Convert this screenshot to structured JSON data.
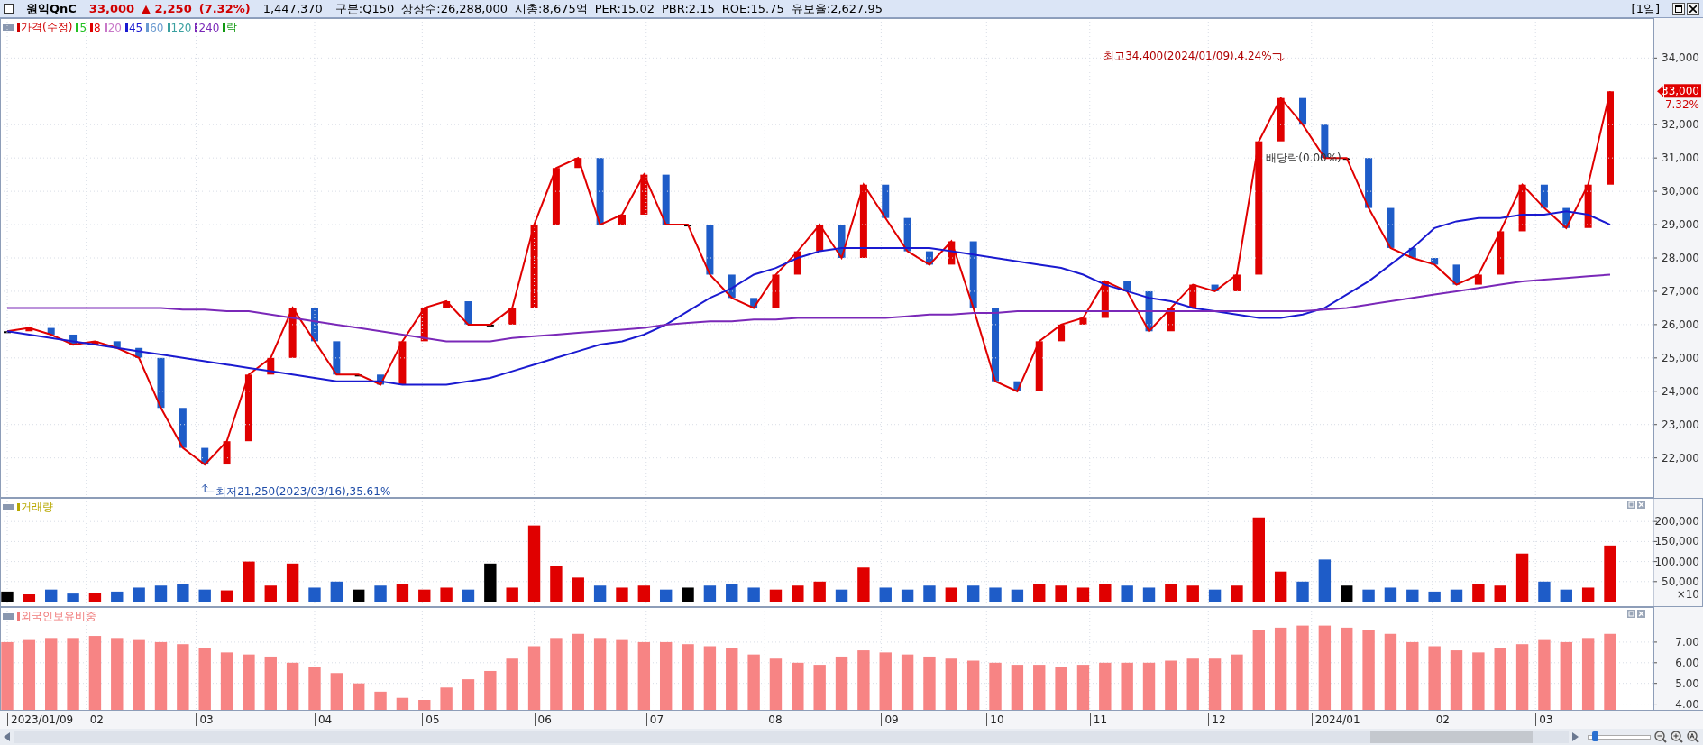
{
  "header": {
    "checked": false,
    "stock_name": "원익QnC",
    "price": "33,000",
    "change": "▲ 2,250",
    "change_rate": "(7.32%)",
    "volume": "1,447,370",
    "stats": [
      "구분:Q150",
      "상장수:26,288,000",
      "시총:8,675억",
      "PER:15.02",
      "PBR:2.15",
      "ROE:15.75",
      "유보율:2,627.95"
    ],
    "period": "[1일]"
  },
  "price_panel": {
    "legend": [
      {
        "label": "가격(수정)",
        "color": "#d00000"
      },
      {
        "label": "5",
        "color": "#22c022"
      },
      {
        "label": "8",
        "color": "#e00000"
      },
      {
        "label": "20",
        "color": "#c878c8"
      },
      {
        "label": "45",
        "color": "#1a1ad0"
      },
      {
        "label": "60",
        "color": "#6a9ad0"
      },
      {
        "label": "120",
        "color": "#3aa0a0"
      },
      {
        "label": "240",
        "color": "#7a28b8"
      },
      {
        "label": "락",
        "color": "#119911"
      }
    ],
    "chart_data": {
      "type": "line",
      "grid": true,
      "ylim": [
        20800,
        35200
      ],
      "yticks": [
        {
          "value": 22000,
          "label": "22,000"
        },
        {
          "value": 23000,
          "label": "23,000"
        },
        {
          "value": 24000,
          "label": "24,000"
        },
        {
          "value": 25000,
          "label": "25,000"
        },
        {
          "value": 26000,
          "label": "26,000"
        },
        {
          "value": 27000,
          "label": "27,000"
        },
        {
          "value": 28000,
          "label": "28,000"
        },
        {
          "value": 29000,
          "label": "29,000"
        },
        {
          "value": 30000,
          "label": "30,000"
        },
        {
          "value": 31000,
          "label": "31,000"
        },
        {
          "value": 32000,
          "label": "32,000"
        },
        {
          "value": 34000,
          "label": "34,000"
        }
      ],
      "series": [
        {
          "color": "#e00000",
          "values": [
            25800,
            25900,
            25700,
            25400,
            25500,
            25300,
            25000,
            23500,
            22300,
            21800,
            22500,
            24500,
            25000,
            26500,
            25500,
            24500,
            24500,
            24200,
            25500,
            26500,
            26700,
            26000,
            26000,
            26500,
            29000,
            30700,
            31000,
            29000,
            29300,
            30500,
            29000,
            29000,
            27500,
            26800,
            26500,
            27500,
            28200,
            29000,
            28000,
            30200,
            29200,
            28200,
            27800,
            28500,
            26500,
            24300,
            24000,
            25500,
            26000,
            26200,
            27300,
            27000,
            25800,
            26500,
            27200,
            27000,
            27500,
            31500,
            32800,
            32000,
            31000,
            31000,
            29500,
            28300,
            28000,
            27800,
            27200,
            27500,
            28800,
            30200,
            29500,
            28900,
            30200,
            33000
          ]
        },
        {
          "color": "#1a1ad0",
          "values": [
            25800,
            25700,
            25600,
            25500,
            25400,
            25300,
            25200,
            25100,
            25000,
            24900,
            24800,
            24700,
            24600,
            24500,
            24400,
            24300,
            24300,
            24300,
            24200,
            24200,
            24200,
            24300,
            24400,
            24600,
            24800,
            25000,
            25200,
            25400,
            25500,
            25700,
            26000,
            26400,
            26800,
            27100,
            27500,
            27700,
            28000,
            28200,
            28300,
            28300,
            28300,
            28300,
            28300,
            28200,
            28100,
            28000,
            27900,
            27800,
            27700,
            27500,
            27200,
            27000,
            26800,
            26700,
            26500,
            26400,
            26300,
            26200,
            26200,
            26300,
            26500,
            26900,
            27300,
            27800,
            28300,
            28900,
            29100,
            29200,
            29200,
            29300,
            29300,
            29400,
            29300,
            29000
          ]
        },
        {
          "color": "#7a28b8",
          "values": [
            26500,
            26500,
            26500,
            26500,
            26500,
            26500,
            26500,
            26500,
            26450,
            26450,
            26400,
            26400,
            26300,
            26200,
            26100,
            26000,
            25900,
            25800,
            25700,
            25600,
            25500,
            25500,
            25500,
            25600,
            25650,
            25700,
            25750,
            25800,
            25850,
            25900,
            26000,
            26050,
            26100,
            26100,
            26150,
            26150,
            26200,
            26200,
            26200,
            26200,
            26200,
            26250,
            26300,
            26300,
            26350,
            26350,
            26400,
            26400,
            26400,
            26400,
            26400,
            26400,
            26400,
            26400,
            26400,
            26400,
            26400,
            26400,
            26400,
            26400,
            26450,
            26500,
            26600,
            26700,
            26800,
            26900,
            27000,
            27100,
            27200,
            27300,
            27350,
            27400,
            27450,
            27500
          ]
        }
      ],
      "annotations": [
        "최고34,400(2024/01/09),4.24%",
        "최저21,250(2023/03/16),35.61%",
        "배당락(0.00%)"
      ]
    },
    "price_tag": {
      "price": "33,000",
      "change": "7.32%"
    }
  },
  "volume_panel": {
    "legend": [
      {
        "label": "거래량",
        "color": "#b8a800"
      }
    ],
    "unit": "×10",
    "chart_data": {
      "type": "bar",
      "grid": true,
      "ylim": [
        0,
        259000
      ],
      "yticks": [
        {
          "value": 50000,
          "label": "50,000"
        },
        {
          "value": 100000,
          "label": "100,000"
        },
        {
          "value": 150000,
          "label": "150,000"
        },
        {
          "value": 200000,
          "label": "200,000"
        }
      ],
      "series": [
        {
          "values": [
            25000,
            18000,
            30000,
            20000,
            22000,
            25000,
            35000,
            40000,
            45000,
            30000,
            28000,
            100000,
            40000,
            95000,
            35000,
            50000,
            30000,
            40000,
            45000,
            30000,
            35000,
            30000,
            95000,
            35000,
            190000,
            90000,
            60000,
            40000,
            35000,
            40000,
            30000,
            35000,
            40000,
            45000,
            35000,
            30000,
            40000,
            50000,
            30000,
            85000,
            35000,
            30000,
            40000,
            35000,
            40000,
            35000,
            30000,
            45000,
            40000,
            35000,
            45000,
            40000,
            35000,
            45000,
            40000,
            30000,
            40000,
            210000,
            75000,
            50000,
            105000,
            40000,
            30000,
            35000,
            30000,
            25000,
            30000,
            45000,
            40000,
            120000,
            50000,
            30000,
            35000,
            140000
          ]
        }
      ]
    }
  },
  "foreign_panel": {
    "legend": [
      {
        "label": "외국인보유비중",
        "color": "#f07878"
      }
    ],
    "chart_data": {
      "type": "bar",
      "grid": true,
      "ylim": [
        3.72,
        8.7
      ],
      "yticks": [
        {
          "value": 4,
          "label": "4.00"
        },
        {
          "value": 5,
          "label": "5.00"
        },
        {
          "value": 6,
          "label": "6.00"
        },
        {
          "value": 7,
          "label": "7.00"
        }
      ],
      "series": [
        {
          "color": "#f78484",
          "values": [
            7.0,
            7.1,
            7.2,
            7.2,
            7.3,
            7.2,
            7.1,
            7.0,
            6.9,
            6.7,
            6.5,
            6.4,
            6.3,
            6.0,
            5.8,
            5.5,
            5.0,
            4.6,
            4.3,
            4.2,
            4.8,
            5.2,
            5.6,
            6.2,
            6.8,
            7.2,
            7.4,
            7.2,
            7.1,
            7.0,
            7.0,
            6.9,
            6.8,
            6.7,
            6.4,
            6.2,
            6.0,
            5.9,
            6.3,
            6.6,
            6.5,
            6.4,
            6.3,
            6.2,
            6.1,
            6.0,
            5.9,
            5.9,
            5.8,
            5.9,
            6.0,
            6.0,
            6.0,
            6.1,
            6.2,
            6.2,
            6.4,
            7.6,
            7.7,
            7.8,
            7.8,
            7.7,
            7.6,
            7.4,
            7.0,
            6.8,
            6.6,
            6.5,
            6.7,
            6.9,
            7.1,
            7.0,
            7.2,
            7.4
          ]
        }
      ]
    }
  },
  "date_axis": [
    "2023/01/09",
    "02",
    "03",
    "04",
    "05",
    "06",
    "07",
    "08",
    "09",
    "10",
    "11",
    "12",
    "2024/01",
    "02",
    "03"
  ],
  "zoom_slider": {
    "level": 0.08
  }
}
